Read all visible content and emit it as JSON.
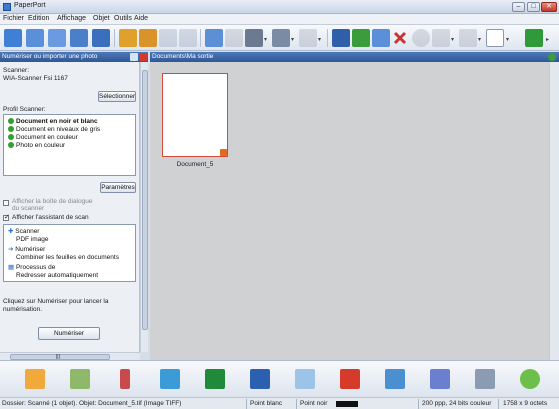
{
  "window": {
    "title": "PaperPort",
    "minimize": "–",
    "maximize": "□",
    "close": "✕"
  },
  "menu": [
    "Fichier",
    "Edition",
    "Affichage",
    "Objet",
    "Outils",
    "Aide"
  ],
  "toolbar": {
    "icons": [
      "folders-icon",
      "scan-icon",
      "document-icon",
      "pagethumb-icon",
      "show-icon",
      "send-icon",
      "image-icon",
      "pencil-icon",
      "highlight-icon",
      "pageview-icon",
      "grid-icon",
      "pc-icon",
      "list-icon",
      "filter-icon",
      "stack-icon",
      "unstack-icon",
      "copy-icon",
      "delete-icon",
      "ocr-icon",
      "rotate-icon",
      "arrange-icon",
      "layout-icon",
      "help-icon"
    ],
    "colors": {
      "blue": "#2f6fcf",
      "green": "#3a9c3a",
      "red": "#c93333",
      "gray": "#9aa4b3"
    }
  },
  "left_panel": {
    "header": "Numériser ou importer une photo",
    "scanner_label": "Scanner:",
    "scanner_value": "WIA-Scanner Fsi 1167",
    "select_button": "Sélectionner",
    "profiles_label": "Profil Scanner:",
    "profiles": [
      {
        "label": "Document en noir et blanc",
        "selected": true
      },
      {
        "label": "Document en niveaux de gris",
        "selected": false
      },
      {
        "label": "Document en couleur",
        "selected": false
      },
      {
        "label": "Photo en couleur",
        "selected": false
      }
    ],
    "options_button": "Paramètres",
    "checkbox1": "Afficher la boîte de dialogue",
    "checkbox1b": "du scanner",
    "checkbox2": "Afficher l'assistant de scan",
    "actions": [
      {
        "label": "Scanner",
        "icon": "scan-icon"
      },
      {
        "label": "PDF image",
        "icon": "pdf-icon"
      },
      {
        "label": "Numériser",
        "icon": "arrow-icon"
      },
      {
        "label": "Combiner les feuilles en documents",
        "icon": ""
      },
      {
        "label": "Processus de",
        "icon": "process-icon"
      },
      {
        "label": "Redresser automatiquement",
        "icon": ""
      }
    ],
    "hint": "Cliquez sur Numériser pour lancer la numérisation.",
    "scan_button": "Numériser",
    "scroll_label": "|||"
  },
  "right_panel": {
    "header": "Documents\\Ma sortie",
    "thumbnail_label": "Document_5"
  },
  "bottom_bar": {
    "icons": [
      "folder-icon",
      "mail-icon",
      "sniptool-icon",
      "3d-icon",
      "excel-icon",
      "word-icon",
      "notepad-icon",
      "pdf-red-icon",
      "scan-app-icon",
      "paint-icon",
      "printer-icon",
      "recycle-icon"
    ]
  },
  "status": {
    "selection": "Dossier: Scanné (1 objet). Objet: Document_5.tif (Image TIFF)",
    "point_white": "Point blanc",
    "point_black": "Point noir",
    "resolution": "200 ppp, 24 bits couleur",
    "size": "1758 x 9 octets"
  }
}
